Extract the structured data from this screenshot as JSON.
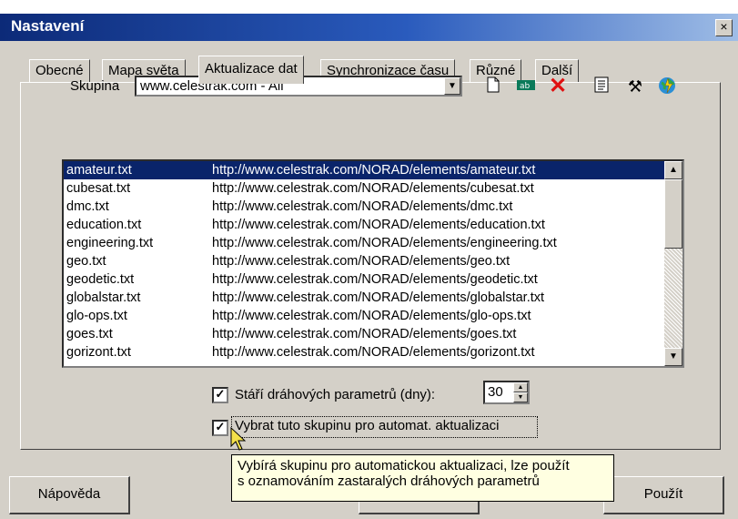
{
  "window": {
    "title": "Nastavení",
    "close_label": "×"
  },
  "tabs": [
    {
      "label": "Obecné"
    },
    {
      "label": "Mapa světa"
    },
    {
      "label": "Aktualizace dat"
    },
    {
      "label": "Synchronizace času"
    },
    {
      "label": "Různé"
    },
    {
      "label": "Další"
    }
  ],
  "group": {
    "label": "Skupina",
    "value": "www.celestrak.com - All"
  },
  "toolbar_icons": [
    "new-document-icon",
    "edit-field-icon",
    "delete-icon",
    "properties-icon",
    "tools-icon",
    "update-globe-icon"
  ],
  "list": {
    "rows": [
      {
        "file": "amateur.txt",
        "url": "http://www.celestrak.com/NORAD/elements/amateur.txt"
      },
      {
        "file": "cubesat.txt",
        "url": "http://www.celestrak.com/NORAD/elements/cubesat.txt"
      },
      {
        "file": "dmc.txt",
        "url": "http://www.celestrak.com/NORAD/elements/dmc.txt"
      },
      {
        "file": "education.txt",
        "url": "http://www.celestrak.com/NORAD/elements/education.txt"
      },
      {
        "file": "engineering.txt",
        "url": "http://www.celestrak.com/NORAD/elements/engineering.txt"
      },
      {
        "file": "geo.txt",
        "url": "http://www.celestrak.com/NORAD/elements/geo.txt"
      },
      {
        "file": "geodetic.txt",
        "url": "http://www.celestrak.com/NORAD/elements/geodetic.txt"
      },
      {
        "file": "globalstar.txt",
        "url": "http://www.celestrak.com/NORAD/elements/globalstar.txt"
      },
      {
        "file": "glo-ops.txt",
        "url": "http://www.celestrak.com/NORAD/elements/glo-ops.txt"
      },
      {
        "file": "goes.txt",
        "url": "http://www.celestrak.com/NORAD/elements/goes.txt"
      },
      {
        "file": "gorizont.txt",
        "url": "http://www.celestrak.com/NORAD/elements/gorizont.txt"
      }
    ]
  },
  "age_option": {
    "label": "Stáří dráhových parametrů (dny):",
    "checked": true,
    "value": "30"
  },
  "auto_option": {
    "label": "Vybrat tuto skupinu pro automat. aktualizaci",
    "checked": true
  },
  "tooltip": {
    "line1": "Vybírá skupinu pro automatickou aktualizaci, lze použít",
    "line2": "s oznamováním zastaralých dráhových parametrů"
  },
  "buttons": {
    "help": "Nápověda",
    "apply": "Použít"
  },
  "colors": {
    "title_start": "#0c2a78",
    "selection": "#0a246a",
    "face": "#d4d0c8",
    "tooltip_bg": "#ffffe1"
  }
}
